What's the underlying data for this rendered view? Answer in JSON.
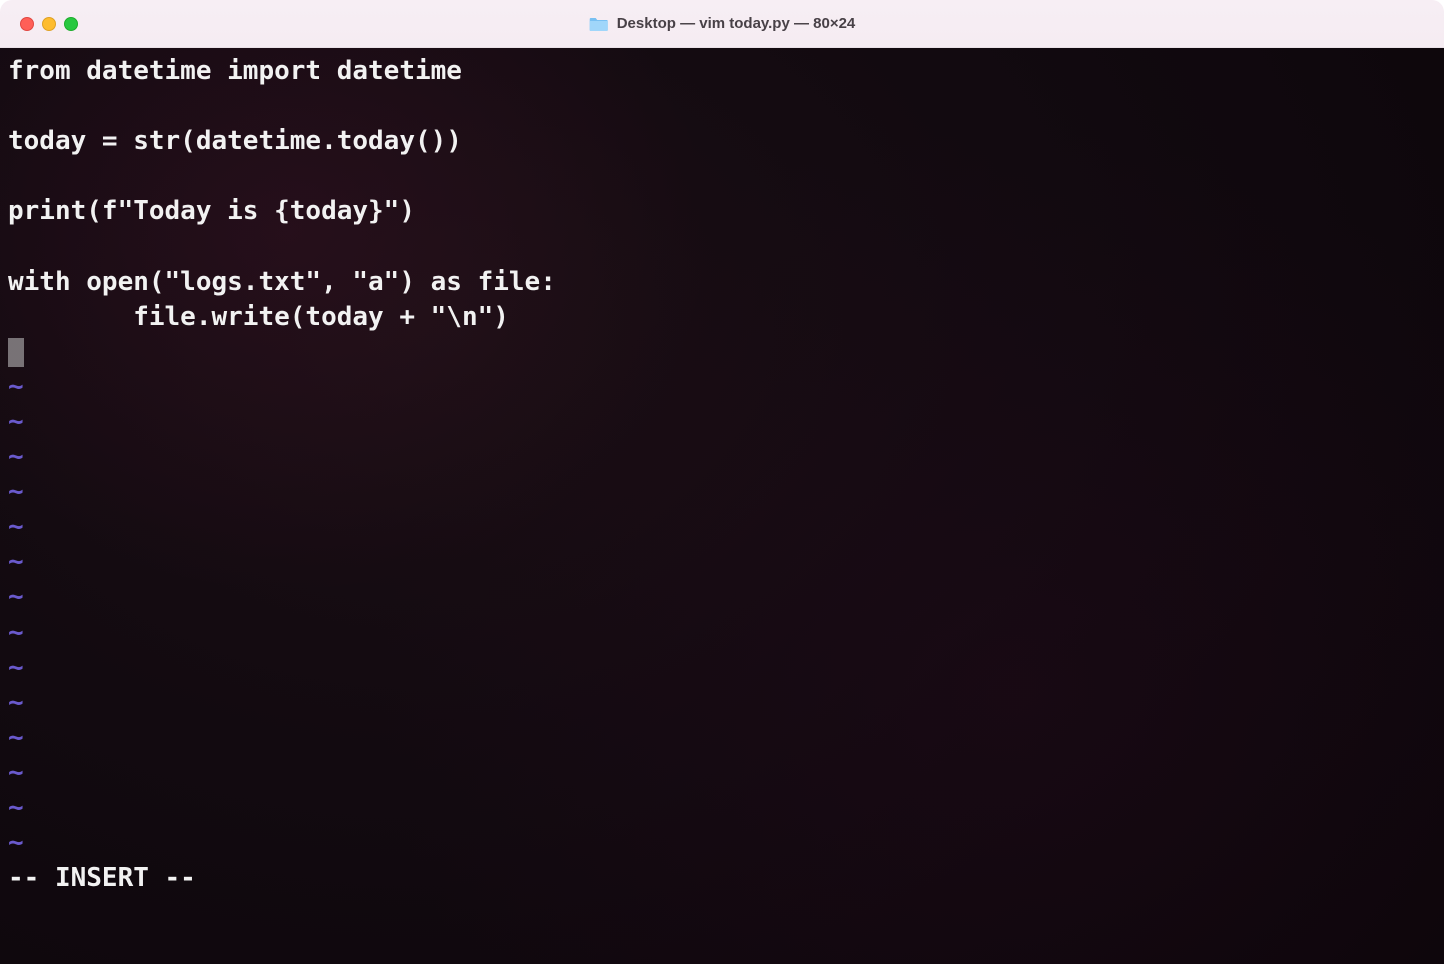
{
  "titlebar": {
    "title": "Desktop — vim today.py — 80×24",
    "folder_icon": "folder-icon"
  },
  "editor": {
    "lines": [
      "from datetime import datetime",
      "",
      "today = str(datetime.today())",
      "",
      "print(f\"Today is {today}\")",
      "",
      "with open(\"logs.txt\", \"a\") as file:",
      "        file.write(today + \"\\n\")"
    ],
    "tilde": "~",
    "tilde_count": 13,
    "status": "-- INSERT --"
  },
  "colors": {
    "titlebar_bg": "#f5ecf2",
    "terminal_bg": "#12090f",
    "text": "#f2f2f2",
    "tilde": "#6a5acd",
    "traffic_close": "#ff5f57",
    "traffic_min": "#febc2e",
    "traffic_max": "#28c840"
  }
}
